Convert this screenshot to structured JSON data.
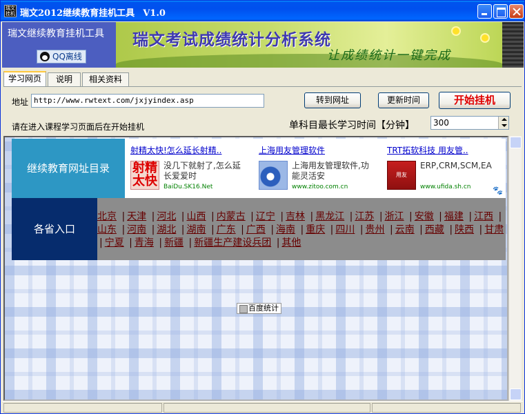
{
  "window": {
    "title": "瑞文2012继续教育挂机工具",
    "version": "V1.0",
    "icon_text": "瑞文挂机"
  },
  "header": {
    "app_name": "瑞文继续教育挂机工具",
    "qq_button": "QQ离线",
    "banner_title": "瑞文考试成绩统计分析系统",
    "banner_slogan": "让成绩统计一键完成"
  },
  "tabs": [
    {
      "label": "学习网页",
      "active": true
    },
    {
      "label": "说明",
      "active": false
    },
    {
      "label": "相关资料",
      "active": false
    }
  ],
  "controls": {
    "address_label": "地址",
    "address_value": "http://www.rwtext.com/jxjyindex.asp",
    "goto_button": "转到网址",
    "update_time_button": "更新时间",
    "start_button": "开始挂机",
    "hint": "请在进入课程学习页面后在开始挂机",
    "max_time_label": "单科目最长学习时间【分钟】",
    "max_time_value": "300"
  },
  "page": {
    "directory_title": "继续教育网址目录",
    "ads": [
      {
        "title": "射精太快!怎么延长射精..",
        "desc": "没几下就射了,怎么延长爱爱时",
        "url": "BaiDu.SK16.Net",
        "img_text": "射精太快"
      },
      {
        "title": "上海用友管理软件",
        "desc": "上海用友管理软件,功能灵活安",
        "url": "www.zitoo.com.cn",
        "img_text": ""
      },
      {
        "title": "TRT拓软科技 用友管..",
        "desc": "ERP,CRM,SCM,EA",
        "url": "www.ufida.sh.cn",
        "img_text": "用友"
      }
    ],
    "provinces_label": "各省入口",
    "provinces": [
      "北京",
      "天津",
      "河北",
      "山西",
      "内蒙古",
      "辽宁",
      "吉林",
      "黑龙江",
      "江苏",
      "浙江",
      "安徽",
      "福建",
      "江西",
      "山东",
      "河南",
      "湖北",
      "湖南",
      "广东",
      "广西",
      "海南",
      "重庆",
      "四川",
      "贵州",
      "云南",
      "西藏",
      "陕西",
      "甘肃",
      "宁夏",
      "青海",
      "新疆",
      "新疆生产建设兵团",
      "其他"
    ],
    "stats_badge": "百度统计"
  },
  "colors": {
    "directory_bg": "#2d97c4",
    "province_label_bg": "#062c6d",
    "province_bg": "#8c8c8c",
    "start_text": "#e00000"
  }
}
